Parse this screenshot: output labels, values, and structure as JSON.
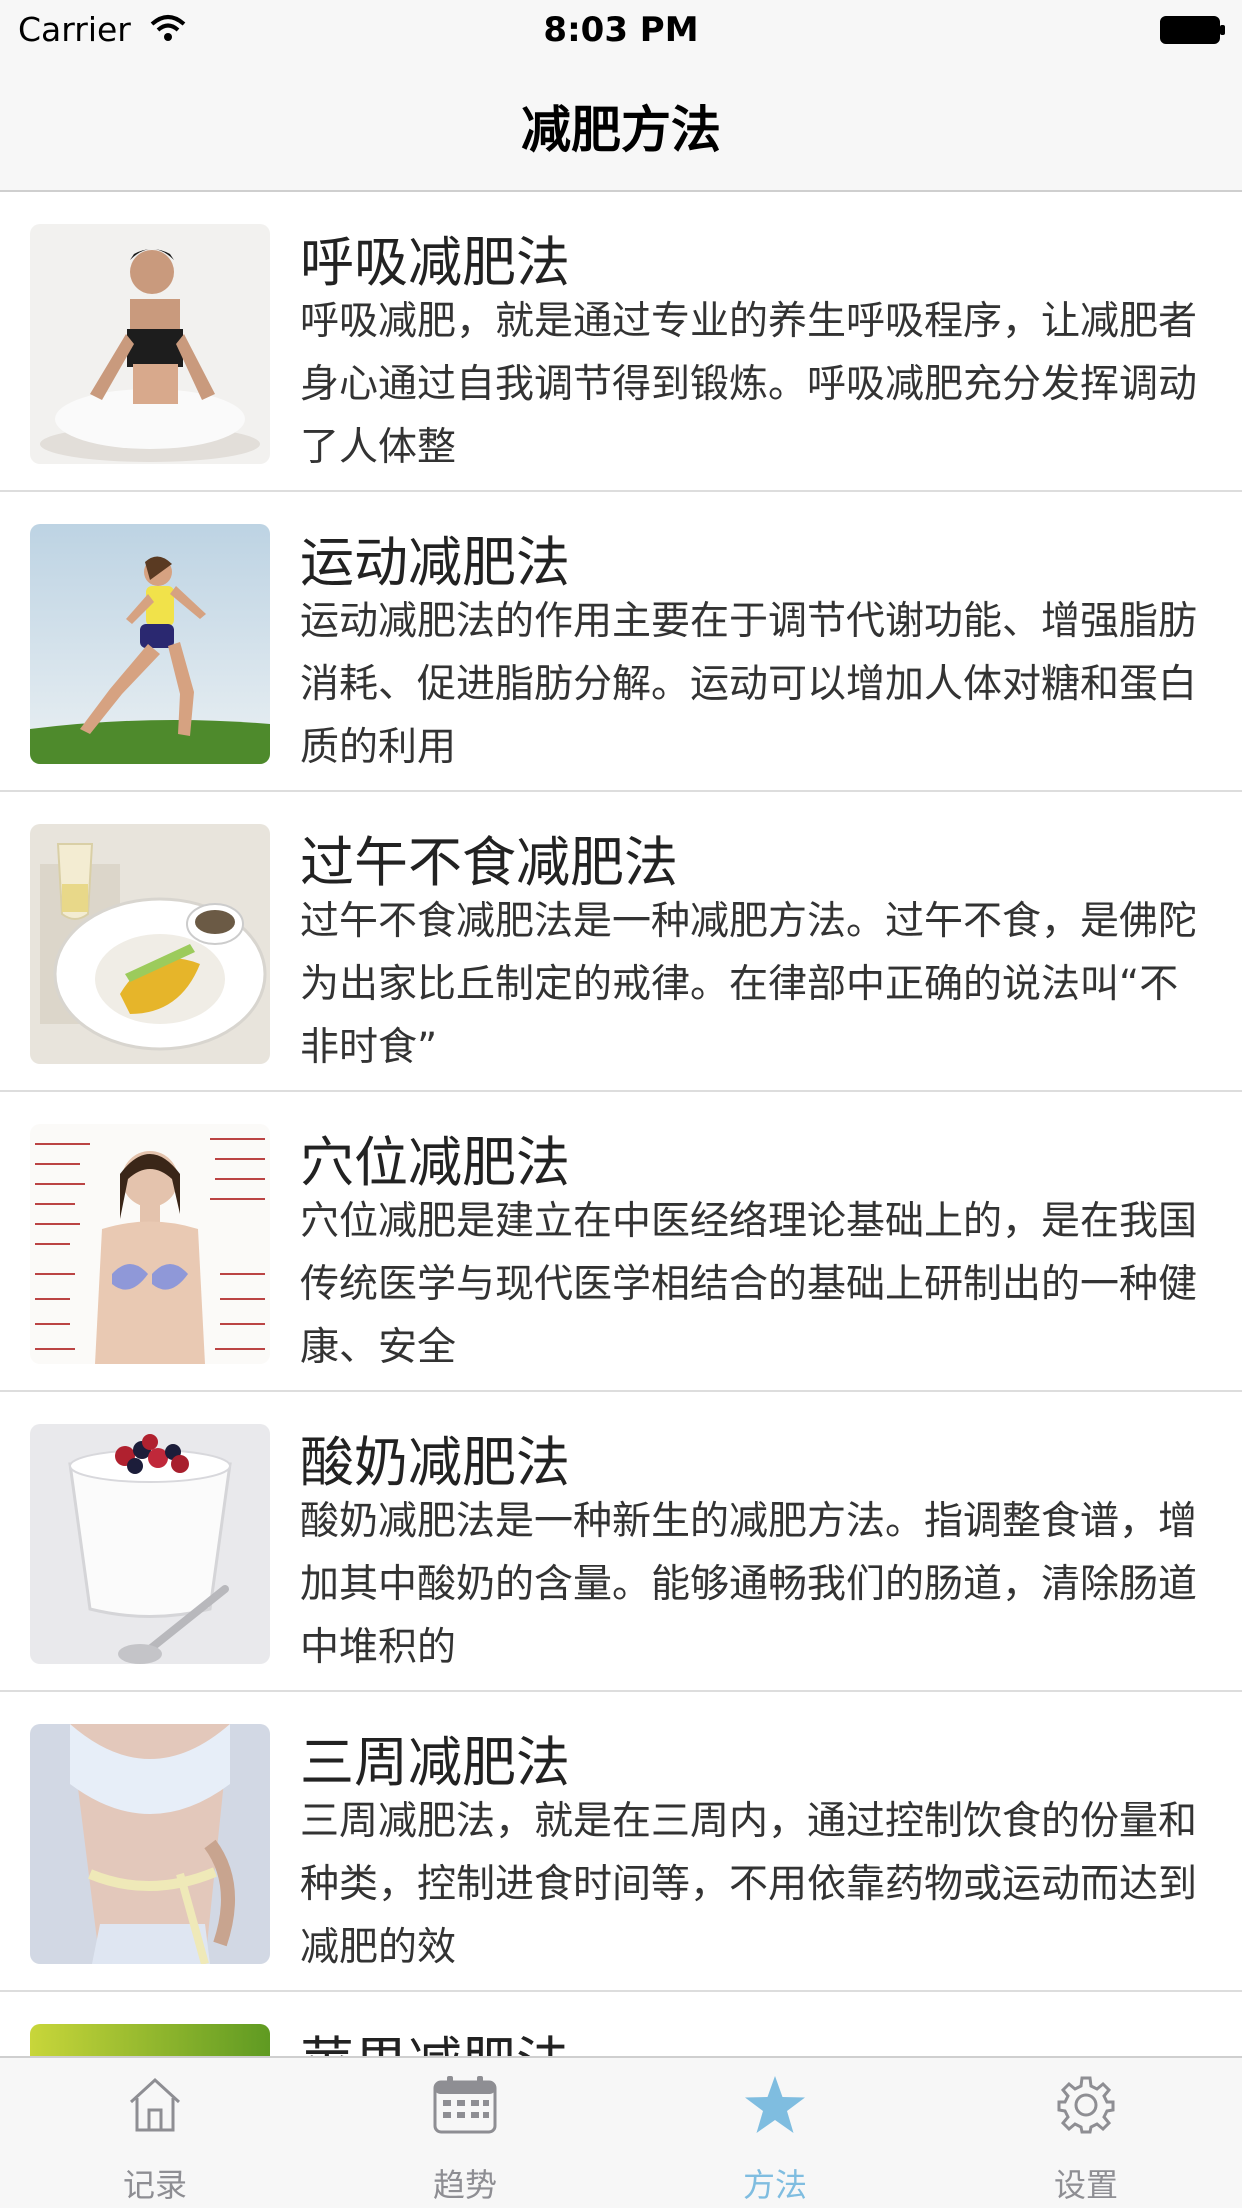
{
  "status": {
    "carrier": "Carrier",
    "time": "8:03 PM"
  },
  "nav": {
    "title": "减肥方法"
  },
  "items": [
    {
      "title": "呼吸减肥法",
      "desc": "呼吸减肥，就是通过专业的养生呼吸程序，让减肥者身心通过自我调节得到锻炼。呼吸减肥充分发挥调动了人体整",
      "thumb": "meditation-photo"
    },
    {
      "title": "运动减肥法",
      "desc": "运动减肥法的作用主要在于调节代谢功能、增强脂肪消耗、促进脂肪分解。运动可以增加人体对糖和蛋白质的利用",
      "thumb": "running-photo"
    },
    {
      "title": "过午不食减肥法",
      "desc": "过午不食减肥法是一种减肥方法。过午不食，是佛陀为出家比丘制定的戒律。在律部中正确的说法叫“不非时食”",
      "thumb": "meal-plate-photo"
    },
    {
      "title": "穴位减肥法",
      "desc": "穴位减肥是建立在中医经络理论基础上的，是在我国传统医学与现代医学相结合的基础上研制出的一种健康、安全",
      "thumb": "acupoint-chart-photo"
    },
    {
      "title": "酸奶减肥法",
      "desc": "酸奶减肥法是一种新生的减肥方法。指调整食谱，增加其中酸奶的含量。能够通畅我们的肠道，清除肠道中堆积的",
      "thumb": "yogurt-photo"
    },
    {
      "title": "三周减肥法",
      "desc": "三周减肥法，就是在三周内，通过控制饮食的份量和种类，控制进食时间等，不用依靠药物或运动而达到减肥的效",
      "thumb": "waist-tape-photo"
    },
    {
      "title": "苹果减肥法",
      "desc": "",
      "thumb": "green-photo"
    }
  ],
  "tabs": [
    {
      "label": "记录",
      "icon": "home-icon",
      "active": false
    },
    {
      "label": "趋势",
      "icon": "calendar-icon",
      "active": false
    },
    {
      "label": "方法",
      "icon": "star-icon",
      "active": true
    },
    {
      "label": "设置",
      "icon": "gear-icon",
      "active": false
    }
  ],
  "colors": {
    "accent": "#7fbde0",
    "bar_bg": "#f7f7f7",
    "inactive": "#8e8e93"
  }
}
